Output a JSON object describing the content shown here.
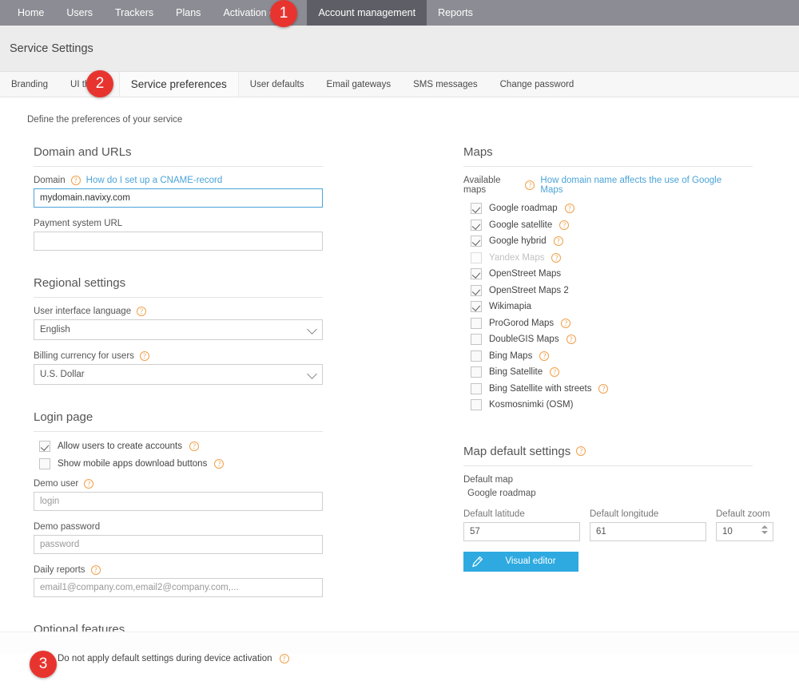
{
  "topnav": {
    "items": [
      {
        "label": "Home",
        "active": false
      },
      {
        "label": "Users",
        "active": false
      },
      {
        "label": "Trackers",
        "active": false
      },
      {
        "label": "Plans",
        "active": false
      },
      {
        "label": "Activation codes",
        "active": false
      },
      {
        "label": "Account management",
        "active": true
      },
      {
        "label": "Reports",
        "active": false
      }
    ]
  },
  "page": {
    "title": "Service Settings",
    "intro": "Define the preferences of your service"
  },
  "tabs": [
    {
      "label": "Branding",
      "active": false
    },
    {
      "label": "UI theme",
      "active": false
    },
    {
      "label": "Service preferences",
      "active": true
    },
    {
      "label": "User defaults",
      "active": false
    },
    {
      "label": "Email gateways",
      "active": false
    },
    {
      "label": "SMS messages",
      "active": false
    },
    {
      "label": "Change password",
      "active": false
    }
  ],
  "domain_section": {
    "title": "Domain and URLs",
    "domain_label": "Domain",
    "cname_link": "How do I set up a CNAME-record",
    "domain_value": "mydomain.navixy.com",
    "payment_label": "Payment system URL",
    "payment_value": ""
  },
  "regional_section": {
    "title": "Regional settings",
    "language_label": "User interface language",
    "language_value": "English",
    "language_options": [
      "English"
    ],
    "currency_label": "Billing currency for users",
    "currency_value": "U.S. Dollar",
    "currency_options": [
      "U.S. Dollar"
    ]
  },
  "login_section": {
    "title": "Login page",
    "allow_create_label": "Allow users to create accounts",
    "allow_create_checked": true,
    "show_mobile_label": "Show mobile apps download buttons",
    "show_mobile_checked": false,
    "demo_user_label": "Demo user",
    "demo_user_placeholder": "login",
    "demo_user_value": "",
    "demo_password_label": "Demo password",
    "demo_password_placeholder": "password",
    "demo_password_value": "",
    "daily_reports_label": "Daily reports",
    "daily_reports_placeholder": "email1@company.com,email2@company.com,...",
    "daily_reports_value": ""
  },
  "optional_section": {
    "title": "Optional features",
    "no_default_label": "Do not apply default settings during device activation",
    "no_default_checked": true
  },
  "maps_section": {
    "title": "Maps",
    "available_label": "Available maps",
    "google_link": "How domain name affects the use of Google Maps",
    "items": [
      {
        "label": "Google roadmap",
        "checked": true,
        "help": true,
        "disabled": false
      },
      {
        "label": "Google satellite",
        "checked": true,
        "help": true,
        "disabled": false
      },
      {
        "label": "Google hybrid",
        "checked": true,
        "help": true,
        "disabled": false
      },
      {
        "label": "Yandex Maps",
        "checked": false,
        "help": true,
        "disabled": true
      },
      {
        "label": "OpenStreet Maps",
        "checked": true,
        "help": false,
        "disabled": false
      },
      {
        "label": "OpenStreet Maps 2",
        "checked": true,
        "help": false,
        "disabled": false
      },
      {
        "label": "Wikimapia",
        "checked": true,
        "help": false,
        "disabled": false
      },
      {
        "label": "ProGorod Maps",
        "checked": false,
        "help": true,
        "disabled": false
      },
      {
        "label": "DoubleGIS Maps",
        "checked": false,
        "help": true,
        "disabled": false
      },
      {
        "label": "Bing Maps",
        "checked": false,
        "help": true,
        "disabled": false
      },
      {
        "label": "Bing Satellite",
        "checked": false,
        "help": true,
        "disabled": false
      },
      {
        "label": "Bing Satellite with streets",
        "checked": false,
        "help": true,
        "disabled": false
      },
      {
        "label": "Kosmosnimki (OSM)",
        "checked": false,
        "help": false,
        "disabled": false
      }
    ]
  },
  "map_defaults": {
    "title": "Map default settings",
    "default_map_label": "Default map",
    "default_map_value": "Google roadmap",
    "latitude_label": "Default latitude",
    "latitude_value": "57",
    "longitude_label": "Default longitude",
    "longitude_value": "61",
    "zoom_label": "Default zoom",
    "zoom_value": "10",
    "visual_editor_label": "Visual editor"
  },
  "badges": [
    {
      "number": "1"
    },
    {
      "number": "2"
    },
    {
      "number": "3"
    }
  ],
  "colors": {
    "nav_bg": "#8c8c94",
    "nav_active_bg": "#5e5e66",
    "accent_link": "#4ba3d8",
    "button_blue": "#2eaae0",
    "badge_red": "#e8342f",
    "help_orange": "#f0a04b"
  }
}
